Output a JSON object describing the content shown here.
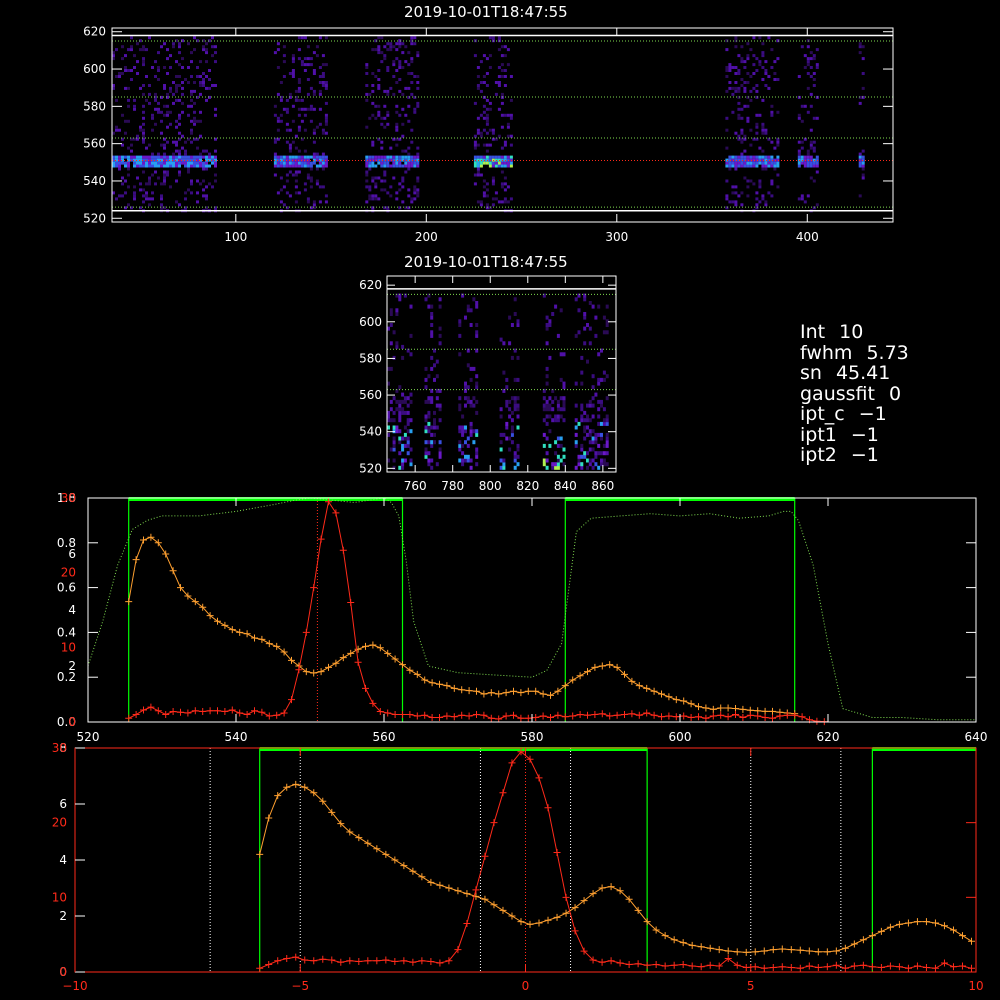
{
  "timestamp_top": "2019-10-01T18:47:55",
  "timestamp_mid": "2019-10-01T18:47:55",
  "info": [
    {
      "key": "Int",
      "value": "10"
    },
    {
      "key": "fwhm",
      "value": "5.73"
    },
    {
      "key": "sn",
      "value": "45.41"
    },
    {
      "key": "gaussfit",
      "value": "0"
    },
    {
      "key": "ipt_c",
      "value": "−1"
    },
    {
      "key": "ipt1",
      "value": "−1"
    },
    {
      "key": "ipt2",
      "value": "−1"
    }
  ],
  "colors": {
    "bg": "#000000",
    "axis": "#ffffff",
    "orange": "#ffa030",
    "red": "#ff2a1a",
    "green": "#00ff00",
    "green_dot": "#7fdc4f",
    "red_axis": "#ff2a1a"
  },
  "chart_data": [
    {
      "type": "heatmap",
      "title": "2019-10-01T18:47:55",
      "xlim": [
        35,
        445
      ],
      "ylim": [
        518,
        622
      ],
      "xticks": [
        100,
        200,
        300,
        400
      ],
      "yticks": [
        520,
        540,
        560,
        580,
        600,
        620
      ],
      "hlines_green": [
        526,
        563,
        585,
        615
      ],
      "hline_red": 551,
      "hlines_white": [
        524,
        618
      ],
      "bands": [
        [
          35,
          90
        ],
        [
          120,
          148
        ],
        [
          168,
          195
        ],
        [
          225,
          245
        ],
        [
          357,
          385
        ],
        [
          395,
          405
        ],
        [
          427,
          430
        ]
      ]
    },
    {
      "type": "heatmap",
      "title": "2019-10-01T18:47:55",
      "xlim": [
        745,
        867
      ],
      "ylim": [
        518,
        625
      ],
      "xticks": [
        760,
        780,
        800,
        820,
        840,
        860
      ],
      "yticks": [
        520,
        540,
        560,
        580,
        600,
        620
      ],
      "hlines_green": [
        563,
        585,
        615
      ],
      "hline_white": 618,
      "columns": [
        [
          745,
          758
        ],
        [
          765,
          773
        ],
        [
          783,
          793
        ],
        [
          805,
          815
        ],
        [
          828,
          840
        ],
        [
          845,
          862
        ]
      ]
    },
    {
      "type": "line",
      "xlim": [
        520,
        640
      ],
      "xticks": [
        520,
        540,
        560,
        580,
        600,
        620,
        640
      ],
      "left_axis_white": {
        "range": [
          0,
          1
        ],
        "ticks": [
          0.0,
          0.2,
          0.4,
          0.6,
          0.8,
          1.0
        ],
        "labels": [
          "0.0",
          "0.2",
          "0.4",
          "0.6",
          "0.8",
          "1.0"
        ]
      },
      "left_axis_mid": {
        "range": [
          0,
          8
        ],
        "ticks": [
          0,
          2,
          4,
          6,
          8
        ],
        "labels": [
          "0",
          "2",
          "4",
          "6",
          "8"
        ]
      },
      "left_axis_red": {
        "range": [
          0,
          30
        ],
        "ticks": [
          0,
          10,
          20,
          30
        ],
        "labels": [
          "0",
          "10",
          "20",
          "30"
        ]
      },
      "green_regions": [
        [
          525.5,
          562.5
        ],
        [
          584.5,
          615.5
        ]
      ],
      "red_dotted_x": 551,
      "transmission": {
        "x": [
          520,
          522,
          524,
          526,
          528,
          530,
          532,
          535,
          540,
          545,
          548,
          550,
          553,
          556,
          558,
          560,
          561,
          562,
          563,
          564,
          566,
          570,
          575,
          580,
          582,
          584,
          585,
          586,
          588,
          592,
          596,
          600,
          604,
          608,
          612,
          614,
          615,
          616,
          618,
          620,
          622,
          626,
          630,
          635,
          640
        ],
        "y": [
          0.25,
          0.45,
          0.7,
          0.86,
          0.9,
          0.92,
          0.92,
          0.92,
          0.94,
          0.97,
          0.99,
          1.0,
          0.99,
          0.98,
          0.99,
          1.0,
          0.98,
          0.92,
          0.72,
          0.45,
          0.25,
          0.22,
          0.21,
          0.2,
          0.23,
          0.35,
          0.6,
          0.85,
          0.91,
          0.92,
          0.93,
          0.92,
          0.93,
          0.91,
          0.92,
          0.94,
          0.94,
          0.9,
          0.7,
          0.35,
          0.06,
          0.02,
          0.02,
          0.01,
          0.01
        ]
      },
      "orange": {
        "x": [
          525.5,
          526.5,
          527.5,
          528.5,
          529.5,
          530.5,
          531.5,
          532.5,
          533.5,
          534.5,
          535.5,
          536.5,
          537.5,
          538.5,
          539.5,
          540.5,
          541.5,
          542.5,
          543.5,
          544.5,
          545.5,
          546.5,
          547.5,
          548.5,
          549.5,
          550.5,
          551.5,
          552.5,
          553.5,
          554.5,
          555.5,
          556.5,
          557.5,
          558.5,
          559.5,
          560.5,
          561.5,
          562.5,
          563.5,
          564.5,
          565.5,
          566.5,
          567.5,
          568.5,
          569.5,
          570.5,
          571.5,
          572.5,
          573.5,
          574.5,
          575.5,
          576.5,
          577.5,
          578.5,
          579.5,
          580.5,
          581.5,
          582.5,
          583.5,
          584.5,
          585.5,
          586.5,
          587.5,
          588.5,
          589.5,
          590.5,
          591.5,
          592.5,
          593.5,
          594.5,
          595.5,
          596.5,
          597.5,
          598.5,
          599.5,
          600.5,
          601.5,
          602.5,
          603.5,
          604.5,
          605.5,
          606.5,
          607.5,
          608.5,
          609.5,
          610.5,
          611.5,
          612.5,
          613.5,
          614.5,
          615.5
        ],
        "y": [
          4.3,
          5.8,
          6.5,
          6.6,
          6.4,
          6.0,
          5.4,
          4.8,
          4.5,
          4.3,
          4.1,
          3.8,
          3.6,
          3.45,
          3.3,
          3.2,
          3.15,
          3.0,
          2.95,
          2.8,
          2.7,
          2.5,
          2.2,
          2.0,
          1.8,
          1.75,
          1.8,
          1.95,
          2.1,
          2.3,
          2.45,
          2.6,
          2.7,
          2.75,
          2.65,
          2.45,
          2.25,
          2.05,
          1.85,
          1.7,
          1.5,
          1.4,
          1.35,
          1.3,
          1.2,
          1.15,
          1.12,
          1.1,
          1.0,
          1.05,
          1.0,
          1.05,
          1.1,
          1.05,
          1.1,
          1.1,
          1.0,
          0.95,
          1.1,
          1.3,
          1.5,
          1.65,
          1.8,
          1.95,
          2.0,
          2.05,
          1.95,
          1.7,
          1.45,
          1.3,
          1.2,
          1.1,
          1.0,
          0.9,
          0.8,
          0.75,
          0.65,
          0.55,
          0.5,
          0.45,
          0.5,
          0.5,
          0.48,
          0.45,
          0.42,
          0.4,
          0.38,
          0.38,
          0.35,
          0.32,
          0.3
        ]
      },
      "red": {
        "x": [
          525.5,
          526.5,
          527.5,
          528.5,
          529.5,
          530.5,
          531.5,
          532.5,
          533.5,
          534.5,
          535.5,
          536.5,
          537.5,
          538.5,
          539.5,
          540.5,
          541.5,
          542.5,
          543.5,
          544.5,
          545.5,
          546.5,
          547.5,
          548.5,
          549.5,
          550.5,
          551.5,
          552.5,
          553.5,
          554.5,
          555.5,
          556.5,
          557.5,
          558.5,
          559.5,
          560.5,
          561.5,
          562.5,
          563.5,
          564.5,
          565.5,
          566.5,
          567.5,
          568.5,
          569.5,
          570.5,
          571.5,
          572.5,
          573.5,
          574.5,
          575.5,
          576.5,
          577.5,
          578.5,
          579.5,
          580.5,
          581.5,
          582.5,
          583.5,
          584.5,
          585.5,
          586.5,
          587.5,
          588.5,
          589.5,
          590.5,
          591.5,
          592.5,
          593.5,
          594.5,
          595.5,
          596.5,
          597.5,
          598.5,
          599.5,
          600.5,
          601.5,
          602.5,
          603.5,
          604.5,
          605.5,
          606.5,
          607.5,
          608.5,
          609.5,
          610.5,
          611.5,
          612.5,
          613.5,
          614.5,
          615.5,
          616.5,
          617.5,
          618.5,
          619.5
        ],
        "y": [
          0.5,
          1.0,
          1.6,
          2.0,
          1.5,
          1.0,
          1.4,
          1.3,
          1.2,
          1.5,
          1.4,
          1.5,
          1.5,
          1.4,
          1.6,
          1.2,
          1.0,
          1.5,
          1.3,
          0.8,
          0.9,
          1.2,
          3.0,
          7.0,
          12.0,
          18.0,
          24.5,
          29.5,
          28.0,
          23.0,
          16.0,
          8.0,
          4.5,
          2.5,
          1.4,
          1.2,
          1.0,
          1.0,
          1.0,
          0.8,
          0.9,
          0.6,
          0.6,
          0.8,
          0.7,
          0.9,
          0.8,
          1.0,
          0.9,
          0.5,
          0.4,
          0.8,
          0.9,
          0.5,
          0.5,
          0.6,
          0.8,
          0.6,
          0.9,
          0.7,
          0.8,
          1.0,
          0.9,
          1.0,
          1.1,
          0.8,
          0.9,
          1.0,
          1.1,
          0.9,
          1.2,
          0.9,
          0.7,
          0.8,
          0.7,
          0.8,
          0.6,
          0.7,
          0.5,
          0.8,
          0.9,
          0.7,
          1.0,
          0.6,
          0.9,
          0.8,
          0.6,
          0.5,
          0.8,
          0.9,
          0.9,
          0.7,
          0.3,
          0.1,
          0.05
        ]
      }
    },
    {
      "type": "line",
      "xlim": [
        -10,
        10
      ],
      "xticks": [
        -10,
        -5,
        0,
        5,
        10
      ],
      "left_axis_mid": {
        "range": [
          0,
          8
        ],
        "ticks": [
          0,
          2,
          4,
          6,
          8
        ],
        "labels": [
          "0",
          "2",
          "4",
          "6",
          "8"
        ]
      },
      "left_axis_red": {
        "range": [
          0,
          30
        ],
        "ticks": [
          0,
          10,
          20,
          30
        ],
        "labels": [
          "0",
          "10",
          "20",
          "30"
        ]
      },
      "green_regions": [
        [
          -5.9,
          2.7
        ],
        [
          7.7,
          10.0
        ]
      ],
      "white_dotted_x": [
        -7.0,
        -5.0,
        -1.0,
        1.0,
        5.0,
        7.0
      ],
      "red_dotted_x": 0,
      "orange": {
        "x": [
          -5.9,
          -5.7,
          -5.5,
          -5.3,
          -5.1,
          -4.9,
          -4.7,
          -4.5,
          -4.3,
          -4.1,
          -3.9,
          -3.7,
          -3.5,
          -3.3,
          -3.1,
          -2.9,
          -2.7,
          -2.5,
          -2.3,
          -2.1,
          -1.9,
          -1.7,
          -1.5,
          -1.3,
          -1.1,
          -0.9,
          -0.7,
          -0.5,
          -0.3,
          -0.1,
          0.1,
          0.3,
          0.5,
          0.7,
          0.9,
          1.1,
          1.3,
          1.5,
          1.7,
          1.9,
          2.1,
          2.3,
          2.5,
          2.7,
          2.9,
          3.1,
          3.3,
          3.5,
          3.7,
          3.9,
          4.1,
          4.3,
          4.5,
          4.7,
          4.9,
          5.1,
          5.3,
          5.5,
          5.7,
          5.9,
          6.1,
          6.3,
          6.5,
          6.7,
          6.9,
          7.1,
          7.3,
          7.5,
          7.7,
          7.9,
          8.1,
          8.3,
          8.5,
          8.7,
          8.9,
          9.1,
          9.3,
          9.5,
          9.7,
          9.9
        ],
        "y": [
          4.2,
          5.5,
          6.3,
          6.6,
          6.7,
          6.6,
          6.4,
          6.1,
          5.7,
          5.3,
          5.0,
          4.8,
          4.6,
          4.4,
          4.2,
          4.0,
          3.8,
          3.6,
          3.4,
          3.2,
          3.1,
          3.0,
          2.9,
          2.8,
          2.7,
          2.6,
          2.4,
          2.2,
          2.0,
          1.8,
          1.7,
          1.75,
          1.85,
          1.95,
          2.1,
          2.3,
          2.55,
          2.8,
          3.0,
          3.05,
          2.9,
          2.6,
          2.2,
          1.8,
          1.5,
          1.3,
          1.15,
          1.05,
          0.95,
          0.9,
          0.85,
          0.8,
          0.75,
          0.72,
          0.7,
          0.72,
          0.75,
          0.8,
          0.82,
          0.8,
          0.78,
          0.75,
          0.72,
          0.72,
          0.75,
          0.85,
          1.0,
          1.15,
          1.3,
          1.45,
          1.6,
          1.7,
          1.75,
          1.8,
          1.8,
          1.75,
          1.65,
          1.5,
          1.3,
          1.1
        ]
      },
      "red": {
        "x": [
          -5.9,
          -5.7,
          -5.5,
          -5.3,
          -5.1,
          -4.9,
          -4.7,
          -4.5,
          -4.3,
          -4.1,
          -3.9,
          -3.7,
          -3.5,
          -3.3,
          -3.1,
          -2.9,
          -2.7,
          -2.5,
          -2.3,
          -2.1,
          -1.9,
          -1.7,
          -1.5,
          -1.3,
          -1.1,
          -0.9,
          -0.7,
          -0.5,
          -0.3,
          -0.1,
          0.1,
          0.3,
          0.5,
          0.7,
          0.9,
          1.1,
          1.3,
          1.5,
          1.7,
          1.9,
          2.1,
          2.3,
          2.5,
          2.7,
          2.9,
          3.1,
          3.3,
          3.5,
          3.7,
          3.9,
          4.1,
          4.3,
          4.5,
          4.7,
          4.9,
          5.1,
          5.3,
          5.5,
          5.7,
          5.9,
          6.1,
          6.3,
          6.5,
          6.7,
          6.9,
          7.1,
          7.3,
          7.5,
          7.7,
          7.9,
          8.1,
          8.3,
          8.5,
          8.7,
          8.9,
          9.1,
          9.3,
          9.5,
          9.7,
          9.9
        ],
        "y": [
          0.5,
          1.0,
          1.5,
          1.8,
          2.0,
          1.6,
          1.5,
          1.7,
          1.6,
          1.3,
          1.5,
          1.4,
          1.5,
          1.5,
          1.6,
          1.4,
          1.5,
          1.3,
          1.5,
          1.4,
          1.2,
          1.5,
          3.0,
          6.5,
          11.0,
          15.5,
          20.0,
          24.0,
          28.0,
          29.5,
          28.5,
          26.0,
          22.0,
          16.0,
          10.0,
          5.5,
          2.8,
          1.6,
          1.3,
          1.5,
          1.2,
          1.0,
          1.1,
          0.9,
          1.0,
          0.8,
          0.9,
          1.0,
          0.8,
          0.7,
          0.9,
          0.8,
          1.8,
          0.9,
          0.6,
          0.7,
          0.5,
          0.6,
          0.7,
          0.6,
          0.5,
          0.8,
          0.6,
          0.7,
          0.9,
          0.5,
          0.8,
          0.9,
          0.7,
          0.6,
          0.8,
          0.7,
          0.5,
          0.8,
          0.6,
          0.5,
          1.2,
          0.7,
          0.8,
          0.5
        ]
      }
    }
  ]
}
